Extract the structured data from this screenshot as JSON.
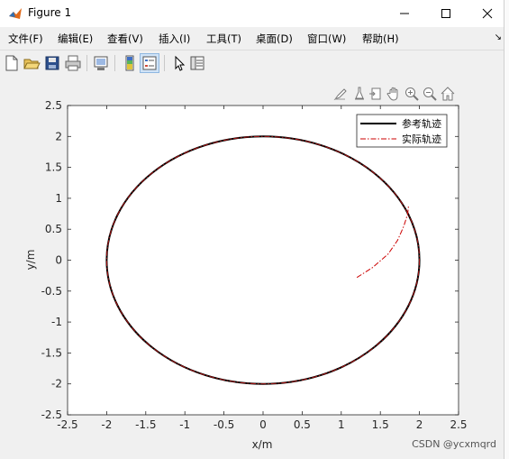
{
  "window": {
    "title": "Figure 1"
  },
  "menu": [
    "文件(F)",
    "编辑(E)",
    "查看(V)",
    "插入(I)",
    "工具(T)",
    "桌面(D)",
    "窗口(W)",
    "帮助(H)"
  ],
  "toolbar_icons": [
    "new-figure-icon",
    "open-file-icon",
    "save-icon",
    "print-icon",
    "link-plot-icon",
    "insert-colorbar-icon",
    "insert-legend-icon",
    "edit-plot-icon",
    "property-inspector-icon"
  ],
  "axes_toolbar_icons": [
    "brush-icon",
    "data-tips-icon",
    "export-icon",
    "pan-icon",
    "zoom-in-icon",
    "zoom-out-icon",
    "home-icon"
  ],
  "watermark": "CSDN @ycxmqrd",
  "chart_data": {
    "type": "line",
    "xlabel": "x/m",
    "ylabel": "y/m",
    "xlim": [
      -2.5,
      2.5
    ],
    "ylim": [
      -2.5,
      2.5
    ],
    "xticks": [
      "-2.5",
      "-2",
      "-1.5",
      "-1",
      "-0.5",
      "0",
      "0.5",
      "1",
      "1.5",
      "2",
      "2.5"
    ],
    "yticks": [
      "2.5",
      "2",
      "1.5",
      "1",
      "0.5",
      "0",
      "-0.5",
      "-1",
      "-1.5",
      "-2",
      "-2.5"
    ],
    "legend_position": "top-right",
    "series": [
      {
        "name": "参考轨迹",
        "color": "#000000",
        "style": "solid",
        "shape": "circle",
        "center": [
          0,
          0
        ],
        "radius": 2
      },
      {
        "name": "实际轨迹",
        "color": "#cc0000",
        "style": "dashdot",
        "x": [
          1.2,
          1.4,
          1.6,
          1.72,
          1.8,
          1.85,
          1.86
        ],
        "y": [
          -0.28,
          -0.12,
          0.1,
          0.32,
          0.55,
          0.75,
          0.88
        ]
      }
    ]
  }
}
